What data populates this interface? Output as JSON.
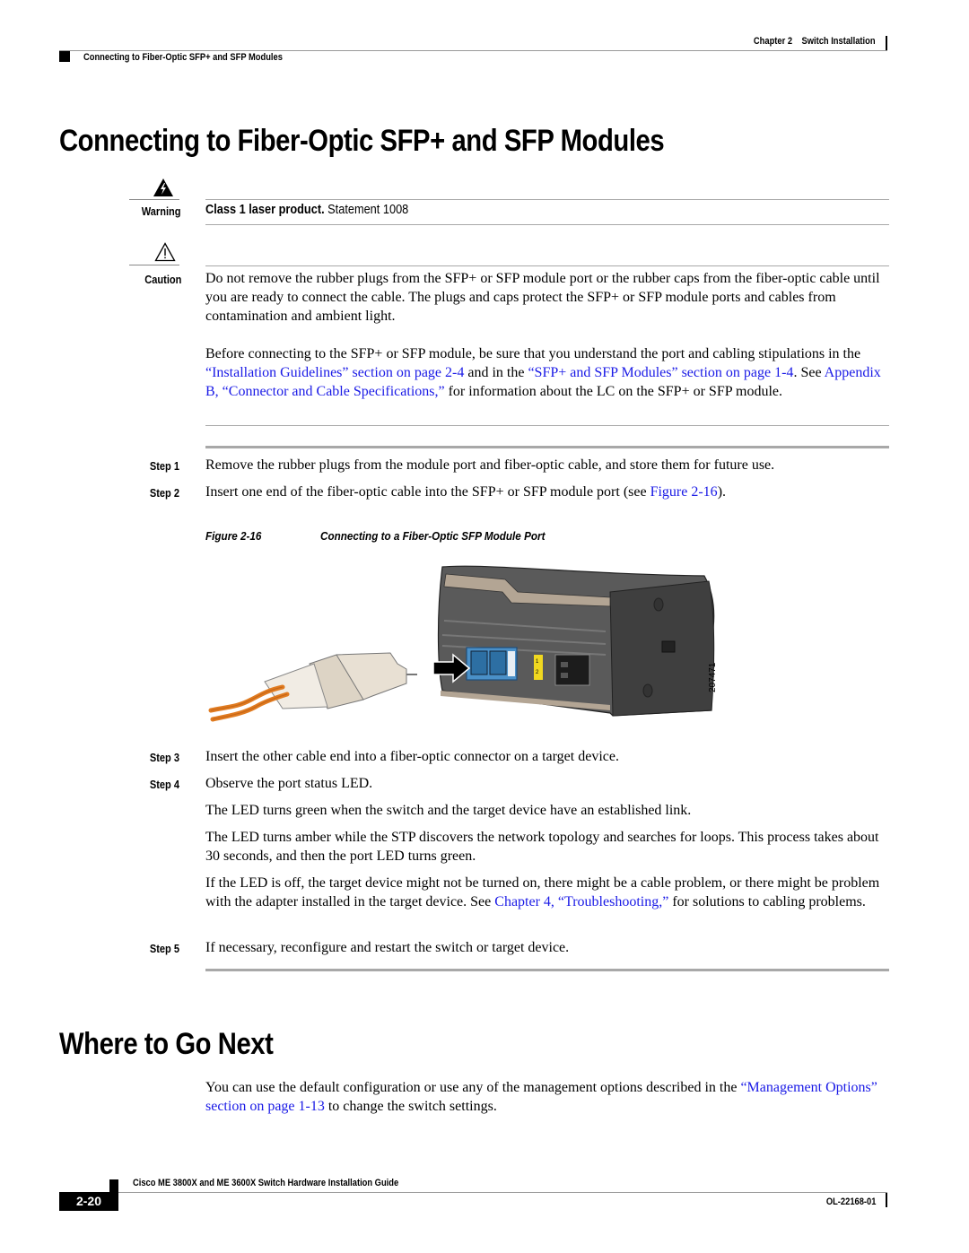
{
  "header": {
    "chapter": "Chapter 2",
    "chapter_title": "Switch Installation",
    "section": "Connecting to Fiber-Optic SFP+ and SFP Modules"
  },
  "section1": {
    "title": "Connecting to Fiber-Optic SFP+ and SFP Modules",
    "warning": {
      "label": "Warning",
      "bold_text": "Class 1 laser product.",
      "text": " Statement 1008",
      "icon": "warning-lightning-icon"
    },
    "caution": {
      "label": "Caution",
      "icon": "caution-triangle-icon",
      "para1": "Do not remove the rubber plugs from the SFP+ or SFP module port or the rubber caps from the fiber-optic cable until you are ready to connect the cable. The plugs and caps protect the SFP+ or SFP module ports and cables from contamination and ambient light.",
      "para2": {
        "t1": "Before connecting to the SFP+ or SFP module, be sure that you understand the port and cabling stipulations in the ",
        "link1": "“Installation Guidelines” section on page 2-4",
        "t2": " and in the ",
        "link2": "“SFP+ and SFP Modules” section on page 1-4",
        "t3": ". See ",
        "link3": "Appendix B, “Connector and Cable Specifications,”",
        "t4": " for information about the LC on the SFP+ or SFP module."
      }
    },
    "steps": [
      {
        "label": "Step 1",
        "text": "Remove the rubber plugs from the module port and fiber-optic cable, and store them for future use."
      },
      {
        "label": "Step 2",
        "text": "Insert one end of the fiber-optic cable into the SFP+ or SFP module port (see ",
        "link": "Figure 2-16",
        "after": ")."
      },
      {
        "label": "Step 3",
        "text": "Insert the other cable end into a fiber-optic connector on a target device."
      },
      {
        "label": "Step 4",
        "text": "Observe the port status LED."
      },
      {
        "label": "Step 5",
        "text": "If necessary, reconfigure and restart the switch or target device."
      }
    ],
    "step4_paras": {
      "p1": "The LED turns green when the switch and the target device have an established link.",
      "p2": "The LED turns amber while the STP discovers the network topology and searches for loops. This process takes about 30 seconds, and then the port LED turns green.",
      "p3_t1": "If the LED is off, the target device might not be turned on, there might be a cable problem, or there might be problem with the adapter installed in the target device. See ",
      "p3_link": "Chapter 4, “Troubleshooting,”",
      "p3_t2": " for solutions to cabling problems."
    },
    "figure": {
      "number": "Figure 2-16",
      "caption": "Connecting to a Fiber-Optic SFP Module Port",
      "art_id": "207471",
      "led_labels": [
        "1",
        "2"
      ]
    }
  },
  "section2": {
    "title": "Where to Go Next",
    "t1": "You can use the default configuration or use any of the management options described in the ",
    "link": "“Management Options” section on page 1-13",
    "t2": " to change the switch settings."
  },
  "footer": {
    "guide_title": "Cisco ME 3800X and ME 3600X Switch Hardware Installation Guide",
    "page_number": "2-20",
    "doc_id": "OL-22168-01"
  }
}
